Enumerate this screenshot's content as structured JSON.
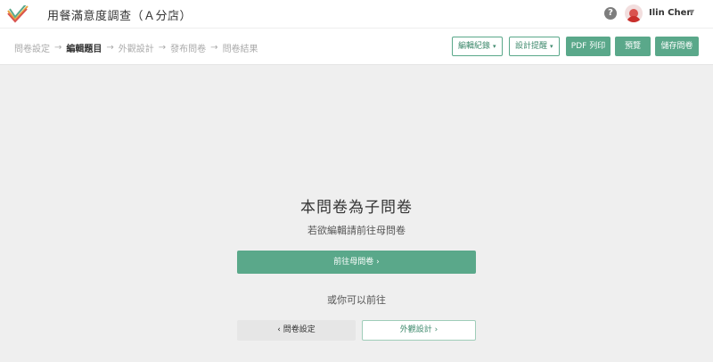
{
  "app": {
    "title": "用餐滿意度調查（Ａ分店）",
    "logo_icon": "checkmark-logo",
    "external_icon": "external-link-icon"
  },
  "user": {
    "help_icon": "?",
    "name": "Ilin Chen",
    "caret": "▼"
  },
  "steps": [
    {
      "label": "問卷設定",
      "active": false
    },
    {
      "label": "編輯題目",
      "active": true
    },
    {
      "label": "外觀設計",
      "active": false
    },
    {
      "label": "發布問卷",
      "active": false
    },
    {
      "label": "問卷結果",
      "active": false
    }
  ],
  "step_arrow": "→",
  "toolbar": {
    "edit_history": "編輯紀錄",
    "design_tips": "設計提醒",
    "dropdown_caret": "▾",
    "pdf_print": "PDF 列印",
    "preview": "預覽",
    "save": "儲存問卷"
  },
  "main": {
    "heading": "本問卷為子問卷",
    "subtitle": "若欲編輯請前往母問卷",
    "goto_parent": "前往母問卷  ›",
    "or_text": "或你可以前往",
    "goto_settings": "‹  問卷設定",
    "goto_design": "外觀設計  ›"
  },
  "colors": {
    "accent": "#5aa88a",
    "background": "#efefef"
  }
}
